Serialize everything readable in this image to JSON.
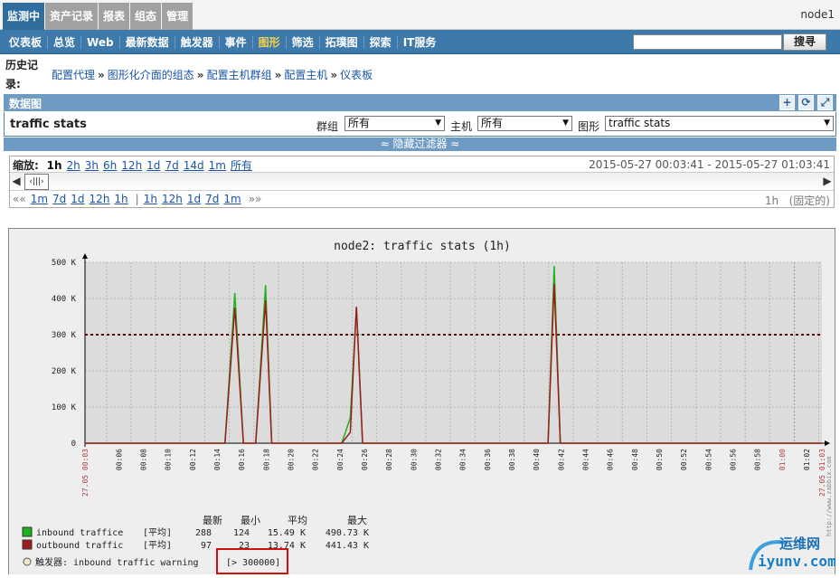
{
  "top_tabs": [
    {
      "label": "监测中",
      "active": true
    },
    {
      "label": "资产记录",
      "active": false
    },
    {
      "label": "报表",
      "active": false
    },
    {
      "label": "组态",
      "active": false
    },
    {
      "label": "管理",
      "active": false
    }
  ],
  "node_name": "node1",
  "menu": [
    {
      "label": "仪表板",
      "active": false
    },
    {
      "label": "总览",
      "active": false
    },
    {
      "label": "Web",
      "active": false
    },
    {
      "label": "最新数据",
      "active": false
    },
    {
      "label": "触发器",
      "active": false
    },
    {
      "label": "事件",
      "active": false
    },
    {
      "label": "图形",
      "active": true
    },
    {
      "label": "筛选",
      "active": false
    },
    {
      "label": "拓璞图",
      "active": false
    },
    {
      "label": "探索",
      "active": false
    },
    {
      "label": "IT服务",
      "active": false
    }
  ],
  "search": {
    "value": "",
    "button_label": "搜寻"
  },
  "history_label": "历史记录:",
  "breadcrumb": [
    "配置代理",
    "图形化介面的组态",
    "配置主机群组",
    "配置主机",
    "仪表板"
  ],
  "breadcrumb_sep": "»",
  "section_title": "数据图",
  "header_icons": [
    "+",
    "⟳",
    "⤢"
  ],
  "filter": {
    "title": "traffic stats",
    "group_label": "群组",
    "group_value": "所有",
    "host_label": "主机",
    "host_value": "所有",
    "graph_label": "图形",
    "graph_value": "traffic stats",
    "hide_filter": "≈ 隐藏过滤器 ≈"
  },
  "zoom": {
    "label": "缩放:",
    "levels": [
      "1h",
      "2h",
      "3h",
      "6h",
      "12h",
      "1d",
      "7d",
      "14d",
      "1m",
      "所有"
    ],
    "active": "1h",
    "period_start": "2015-05-27 00:03:41",
    "period_sep": "-",
    "period_end": "2015-05-27 01:03:41"
  },
  "nav": {
    "back_symbol": "««",
    "back": [
      "1m",
      "7d",
      "1d",
      "12h",
      "1h"
    ],
    "divider": "|",
    "forward": [
      "1h",
      "12h",
      "1d",
      "7d",
      "1m"
    ],
    "forward_symbol": "»»",
    "current": "1h",
    "fixed": "(固定的)"
  },
  "chart_data": {
    "type": "line",
    "title": "node2: traffic stats (1h)",
    "ylim": [
      0,
      500000
    ],
    "y_ticks": [
      "500 K",
      "400 K",
      "300 K",
      "200 K",
      "100 K",
      "0"
    ],
    "x_start_label": "27.05 00:03",
    "x_end_label": "27.05 01:03",
    "x_ticks": [
      "00:06",
      "00:08",
      "00:10",
      "00:12",
      "00:14",
      "00:16",
      "00:18",
      "00:20",
      "00:22",
      "00:24",
      "00:26",
      "00:28",
      "00:30",
      "00:32",
      "00:34",
      "00:36",
      "00:38",
      "00:40",
      "00:42",
      "00:44",
      "00:46",
      "00:48",
      "00:50",
      "00:52",
      "00:54",
      "00:56",
      "00:58",
      "01:00",
      "01:02"
    ],
    "x_highlight_tick": "01:00",
    "threshold": 300000,
    "series": [
      {
        "name": "inbound traffice",
        "color": "#1eb31e",
        "points": [
          [
            0,
            0
          ],
          [
            11.4,
            0
          ],
          [
            12.2,
            415000
          ],
          [
            12.9,
            0
          ],
          [
            13.9,
            0
          ],
          [
            14.7,
            437000
          ],
          [
            15.2,
            0
          ],
          [
            20.9,
            0
          ],
          [
            21.6,
            70000
          ],
          [
            22.1,
            375000
          ],
          [
            22.6,
            0
          ],
          [
            37.7,
            0
          ],
          [
            38.2,
            490000
          ],
          [
            38.7,
            0
          ],
          [
            60,
            0
          ]
        ]
      },
      {
        "name": "outbound traffic",
        "color": "#9c1c1c",
        "points": [
          [
            0,
            0
          ],
          [
            11.4,
            0
          ],
          [
            12.2,
            375000
          ],
          [
            12.9,
            0
          ],
          [
            13.9,
            0
          ],
          [
            14.7,
            395000
          ],
          [
            15.2,
            0
          ],
          [
            20.9,
            0
          ],
          [
            21.6,
            30000
          ],
          [
            22.1,
            377000
          ],
          [
            22.6,
            0
          ],
          [
            37.7,
            0
          ],
          [
            38.2,
            441000
          ],
          [
            38.7,
            0
          ],
          [
            60,
            0
          ]
        ]
      }
    ]
  },
  "legend": {
    "header": {
      "last": "最新",
      "min": "最小",
      "avg": "平均",
      "max": "最大"
    },
    "rows": [
      {
        "name": "inbound traffice",
        "func": "[平均]",
        "last": "288",
        "min": "124",
        "avg": "15.49 K",
        "max": "490.73 K",
        "color": "#1eb31e"
      },
      {
        "name": "outbound traffic",
        "func": "[平均]",
        "last": "97",
        "min": "23",
        "avg": "13.74 K",
        "max": "441.43 K",
        "color": "#9c1c1c"
      }
    ],
    "trigger_label": "触发器: inbound traffic warning",
    "trigger_value": "[> 300000]",
    "side_url": "http://www.zabbix.com"
  },
  "watermark": {
    "cn": "运维网",
    "en": "iyunv.com"
  }
}
